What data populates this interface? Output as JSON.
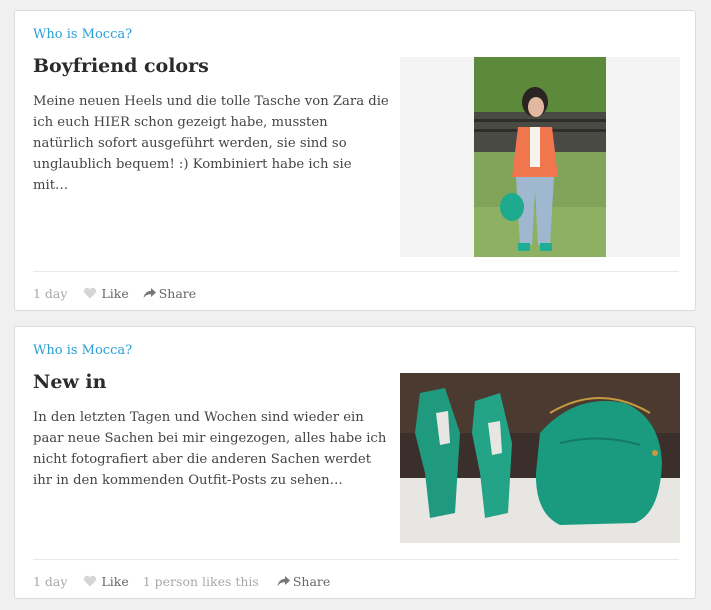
{
  "posts": [
    {
      "source": "Who is Mocca?",
      "title": "Boyfriend colors",
      "excerpt": "Meine neuen Heels und die tolle Tasche von Zara die ich euch HIER schon gezeigt habe, mussten natürlich sofort ausgeführt werden, sie sind so unglaublich bequem! :) Kombiniert habe ich sie mit…",
      "time": "1 day",
      "like_label": "Like",
      "share_label": "Share",
      "image_icon": "outfit-photo"
    },
    {
      "source": "Who is Mocca?",
      "title": "New in",
      "excerpt": "In den letzten Tagen und Wochen sind wieder ein paar neue Sachen bei mir eingezogen, alles habe ich nicht fotografiert aber die anderen Sachen werdet ihr in den kommenden Outfit-Posts zu sehen…",
      "time": "1 day",
      "like_label": "Like",
      "likes_text": "1 person likes this",
      "share_label": "Share",
      "image_icon": "shoes-and-bag-photo"
    }
  ],
  "colors": {
    "link": "#2a9fd6",
    "title": "#2b2b2b",
    "muted": "#a8a8a8"
  }
}
